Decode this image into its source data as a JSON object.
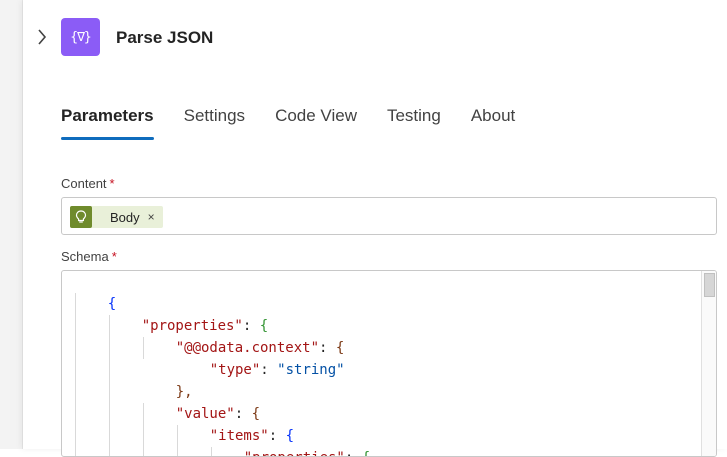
{
  "action": {
    "title": "Parse JSON",
    "icon": "braces-icon",
    "icon_glyph": "{∇}",
    "icon_color": "#8b5cf6"
  },
  "tabs": [
    {
      "label": "Parameters",
      "active": true
    },
    {
      "label": "Settings",
      "active": false
    },
    {
      "label": "Code View",
      "active": false
    },
    {
      "label": "Testing",
      "active": false
    },
    {
      "label": "About",
      "active": false
    }
  ],
  "content": {
    "label": "Content",
    "required_marker": "*",
    "token": {
      "label": "Body",
      "remove": "×",
      "icon": "lightbulb-icon",
      "color": "#6f8b2c"
    }
  },
  "schema": {
    "label": "Schema",
    "required_marker": "*",
    "lines": [
      {
        "open": "{"
      },
      {
        "key": "\"properties\"",
        "colon": ": ",
        "open": "{"
      },
      {
        "key": "\"@@odata.context\"",
        "colon": ": ",
        "open": "{"
      },
      {
        "key": "\"type\"",
        "colon": ": ",
        "value": "\"string\""
      },
      {
        "close": "},"
      },
      {
        "key": "\"value\"",
        "colon": ": ",
        "open": "{"
      },
      {
        "key": "\"items\"",
        "colon": ": ",
        "open": "{"
      },
      {
        "key": "\"properties\"",
        "colon": ": ",
        "open": "{"
      }
    ]
  },
  "colors": {
    "accent": "#0f6cbd",
    "required": "#c50f1f",
    "json_key": "#a31515",
    "json_string": "#0451a5"
  }
}
